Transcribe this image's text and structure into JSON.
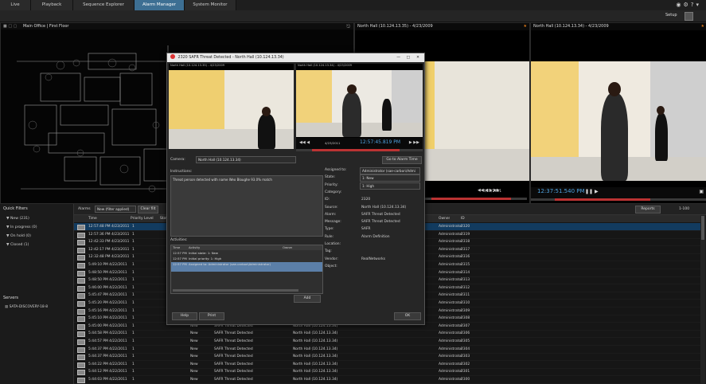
{
  "tabs": [
    "Live",
    "Playback",
    "Sequence Explorer",
    "Alarm Manager",
    "System Monitor"
  ],
  "active_tab": "Alarm Manager",
  "setup_label": "Setup",
  "map": {
    "title": "Main Office | First Floor"
  },
  "cameras": [
    {
      "title": "North Hall (10.124.13.35)  - 4/23/2009"
    },
    {
      "title": "North Hall (10.124.13.34)  - 4/23/2009"
    }
  ],
  "timestamp_right": "12:37:51.540 PM",
  "date_right": "4/23/2011",
  "quick_filters": {
    "title": "Quick Filters",
    "items": [
      "New (231)",
      "In progress (0)",
      "On hold (0)",
      "Closed (1)"
    ]
  },
  "servers": {
    "title": "Servers",
    "items": [
      "SATA-DISCOVERY-18-8"
    ]
  },
  "toolbar": {
    "alarms_label": "Alarms",
    "filter_value": "New (filter applied)",
    "clear_label": "Clear filt",
    "reports_label": "Reports",
    "paging": "1-100"
  },
  "columns": [
    "Time",
    "Priority Level",
    "State",
    "Message",
    "Source",
    "Owner",
    "ID"
  ],
  "rows": [
    {
      "time": "12:57:48 PM 4/23/2011",
      "prio": "1",
      "state": "",
      "msg": "",
      "src": "",
      "owner": "Administrator",
      "id": "2320"
    },
    {
      "time": "12:57:36 PM 4/23/2011",
      "prio": "1",
      "state": "",
      "msg": "",
      "src": "",
      "owner": "Administrator",
      "id": "2319"
    },
    {
      "time": "12:42:33 PM 4/23/2011",
      "prio": "1",
      "state": "",
      "msg": "",
      "src": "",
      "owner": "Administrator",
      "id": "2318"
    },
    {
      "time": "12:42:17 PM 4/23/2011",
      "prio": "1",
      "state": "",
      "msg": "",
      "src": "",
      "owner": "Administrator",
      "id": "2317"
    },
    {
      "time": "12:32:48 PM 4/23/2011",
      "prio": "1",
      "state": "",
      "msg": "",
      "src": "",
      "owner": "Administrator",
      "id": "2316"
    },
    {
      "time": "5:49:10 PM 4/22/2011",
      "prio": "1",
      "state": "",
      "msg": "",
      "src": "",
      "owner": "Administrator",
      "id": "2315"
    },
    {
      "time": "5:48:50 PM 4/22/2011",
      "prio": "1",
      "state": "",
      "msg": "",
      "src": "",
      "owner": "Administrator",
      "id": "2314"
    },
    {
      "time": "5:48:50 PM 4/22/2011",
      "prio": "1",
      "state": "",
      "msg": "",
      "src": "",
      "owner": "Administrator",
      "id": "2313"
    },
    {
      "time": "5:46:00 PM 4/22/2011",
      "prio": "1",
      "state": "",
      "msg": "",
      "src": "",
      "owner": "Administrator",
      "id": "2312"
    },
    {
      "time": "5:45:47 PM 4/22/2011",
      "prio": "1",
      "state": "",
      "msg": "",
      "src": "",
      "owner": "Administrator",
      "id": "2311"
    },
    {
      "time": "5:45:20 PM 4/22/2011",
      "prio": "1",
      "state": "",
      "msg": "",
      "src": "",
      "owner": "Administrator",
      "id": "2310"
    },
    {
      "time": "5:45:16 PM 4/22/2011",
      "prio": "1",
      "state": "",
      "msg": "",
      "src": "",
      "owner": "Administrator",
      "id": "2309"
    },
    {
      "time": "5:45:10 PM 4/22/2011",
      "prio": "1",
      "state": "",
      "msg": "",
      "src": "",
      "owner": "Administrator",
      "id": "2308"
    },
    {
      "time": "5:45:00 PM 4/22/2011",
      "prio": "1",
      "state": "New",
      "msg": "SAFR Threat Detected",
      "src": "North Hall (10.124.13.34)",
      "owner": "Administrator",
      "id": "2307"
    },
    {
      "time": "5:44:58 PM 4/22/2011",
      "prio": "1",
      "state": "New",
      "msg": "SAFR Threat Detected",
      "src": "North Hall (10.124.13.34)",
      "owner": "Administrator",
      "id": "2306"
    },
    {
      "time": "5:44:57 PM 4/22/2011",
      "prio": "1",
      "state": "New",
      "msg": "SAFR Threat Detected",
      "src": "North Hall (10.124.13.34)",
      "owner": "Administrator",
      "id": "2305"
    },
    {
      "time": "5:44:37 PM 4/22/2011",
      "prio": "1",
      "state": "New",
      "msg": "SAFR Threat Detected",
      "src": "North Hall (10.124.13.34)",
      "owner": "Administrator",
      "id": "2304"
    },
    {
      "time": "5:44:37 PM 4/22/2011",
      "prio": "1",
      "state": "New",
      "msg": "SAFR Threat Detected",
      "src": "North Hall (10.124.13.34)",
      "owner": "Administrator",
      "id": "2303"
    },
    {
      "time": "5:44:22 PM 4/22/2011",
      "prio": "1",
      "state": "New",
      "msg": "SAFR Threat Detected",
      "src": "North Hall (10.124.13.34)",
      "owner": "Administrator",
      "id": "2302"
    },
    {
      "time": "5:44:12 PM 4/22/2011",
      "prio": "1",
      "state": "New",
      "msg": "SAFR Threat Detected",
      "src": "North Hall (10.124.13.34)",
      "owner": "Administrator",
      "id": "2301"
    },
    {
      "time": "5:44:03 PM 4/22/2011",
      "prio": "1",
      "state": "New",
      "msg": "SAFR Threat Detected",
      "src": "North Hall (10.124.13.34)",
      "owner": "Administrator",
      "id": "2300"
    }
  ],
  "dialog": {
    "title": "2320 SAFR Threat Detected - North Hall (10.124.13.34)",
    "cam1_title": "North Hall (10.124.13.35) - 4/23/2009",
    "cam2_title": "North Hall (10.124.13.34) - 4/23/2009",
    "video_time": "12:57:45.819 PM",
    "video_date": "4/23/2011",
    "camera_label": "Camera:",
    "camera_value": "North Hall (10.124.13.34)",
    "goto_label": "Go to Alarm Time",
    "instructions_label": "Instructions:",
    "instructions_text": "Threat person detected with name Weo Bloughe  93.0% match",
    "fields": [
      {
        "label": "Assigned to:",
        "value": "Administrator (sae-carbon\\Admi"
      },
      {
        "label": "State:",
        "value": "1: New"
      },
      {
        "label": "Priority:",
        "value": "1: High"
      },
      {
        "label": "Category:",
        "value": ""
      },
      {
        "label": "ID:",
        "value": "2320"
      },
      {
        "label": "Source:",
        "value": "North Hall (10.124.13.34)"
      },
      {
        "label": "Alarm:",
        "value": "SAFR Threat Detected"
      },
      {
        "label": "Message:",
        "value": "SAFR Threat Detected"
      },
      {
        "label": "Type:",
        "value": "SAFR"
      },
      {
        "label": "Rule:",
        "value": "Alarm Definition"
      },
      {
        "label": "Location:",
        "value": ""
      },
      {
        "label": "Tag:",
        "value": ""
      },
      {
        "label": "Vendor:",
        "value": "RealNetworks"
      },
      {
        "label": "Object:",
        "value": ""
      }
    ],
    "activities_label": "Activities:",
    "activity_columns": [
      "Time",
      "Activity",
      "Owner"
    ],
    "activities": [
      {
        "time": "12:57 PM",
        "text": "Initial state: 1: New"
      },
      {
        "time": "12:57 PM",
        "text": "Initial priority: 1: High"
      },
      {
        "time": "12:57 PM",
        "text": "Assigned to: Administrator (sae-carbon\\Administrator)"
      }
    ],
    "add_label": "Add",
    "help_label": "Help",
    "print_label": "Print",
    "ok_label": "OK"
  }
}
